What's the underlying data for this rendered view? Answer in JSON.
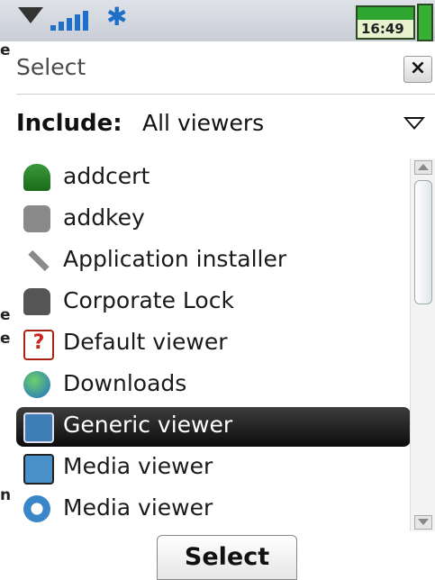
{
  "status_bar": {
    "time": "16:49"
  },
  "background_fragments": [
    "e",
    "e",
    "e",
    "n"
  ],
  "dialog": {
    "title": "Select",
    "close_label": "×",
    "include_label": "Include:",
    "include_value": "All viewers"
  },
  "list": {
    "items": [
      {
        "label": "addcert",
        "icon": "certificate-icon"
      },
      {
        "label": "addkey",
        "icon": "key-icon"
      },
      {
        "label": "Application installer",
        "icon": "wrench-icon"
      },
      {
        "label": "Corporate Lock",
        "icon": "lock-icon"
      },
      {
        "label": "Default viewer",
        "icon": "question-icon"
      },
      {
        "label": "Downloads",
        "icon": "globe-icon"
      },
      {
        "label": "Generic viewer",
        "icon": "eye-icon",
        "selected": true
      },
      {
        "label": "Media viewer",
        "icon": "film-icon"
      },
      {
        "label": "Media viewer",
        "icon": "media-icon"
      }
    ]
  },
  "softkey": {
    "select_label": "Select"
  },
  "colors": {
    "selection": "#1a1a1a",
    "status_bar": "#d3d7de",
    "accent": "#1e6fc8"
  }
}
